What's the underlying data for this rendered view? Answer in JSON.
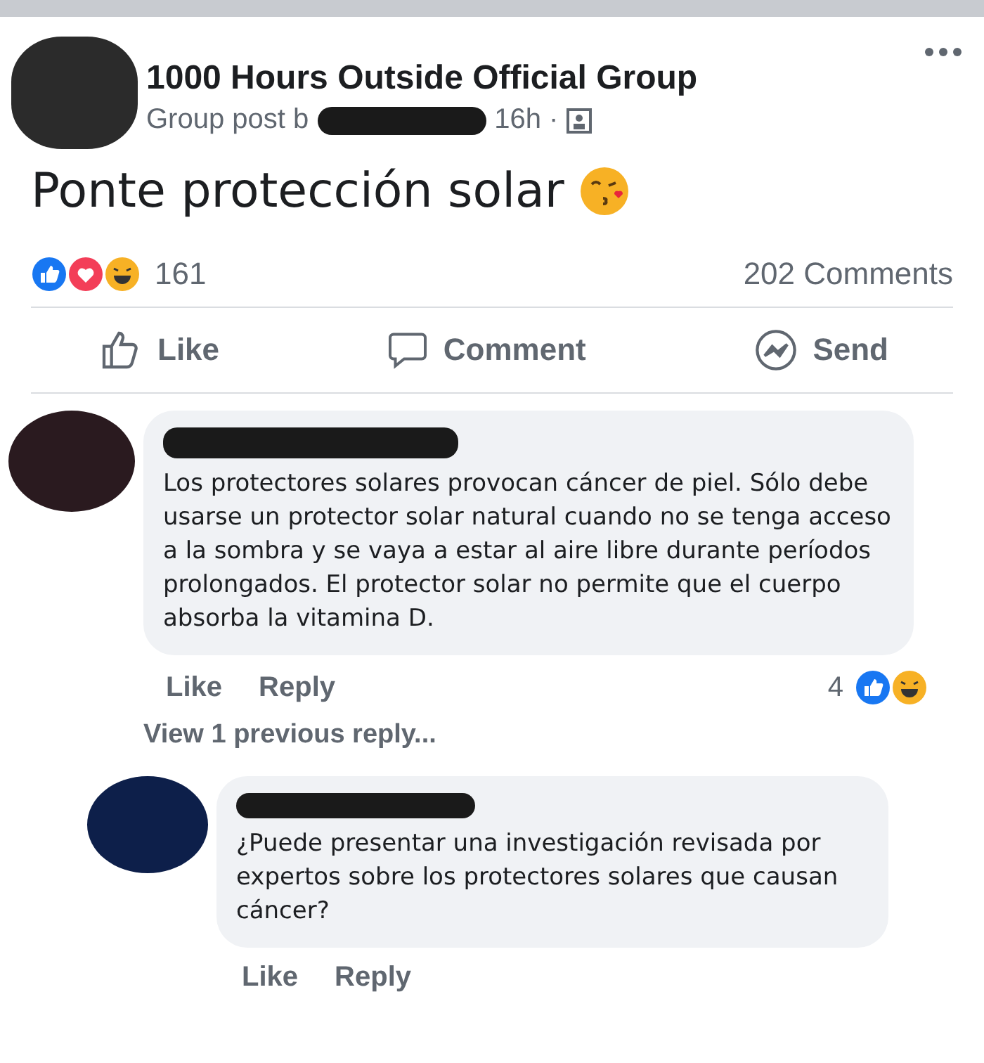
{
  "group": {
    "title": "1000 Hours Outside Official Group",
    "subtitle": "Group post b",
    "time": "16h ·"
  },
  "post": {
    "text": "Ponte protección solar"
  },
  "reactions": {
    "count": "161",
    "comments": "202 Comments"
  },
  "actions": [
    {
      "kind": "like",
      "label": "Like"
    },
    {
      "kind": "comment",
      "label": "Comment"
    },
    {
      "kind": "send",
      "label": "Send"
    }
  ],
  "comment": {
    "text": "Los protectores solares provocan cáncer de piel. Sólo debe usarse un protector solar natural cuando no se tenga acceso a la sombra y se vaya a estar al aire libre durante períodos prolongados. El protector solar no permite que el cuerpo absorba la vitamina D.",
    "actions": [
      "Like",
      "Reply"
    ],
    "reaction_count": "4",
    "view_previous": "View 1 previous reply..."
  },
  "reply": {
    "text": "¿Puede presentar una investigación revisada por expertos sobre los protectores solares que causan cáncer?",
    "actions": [
      "Like",
      "Reply"
    ]
  }
}
